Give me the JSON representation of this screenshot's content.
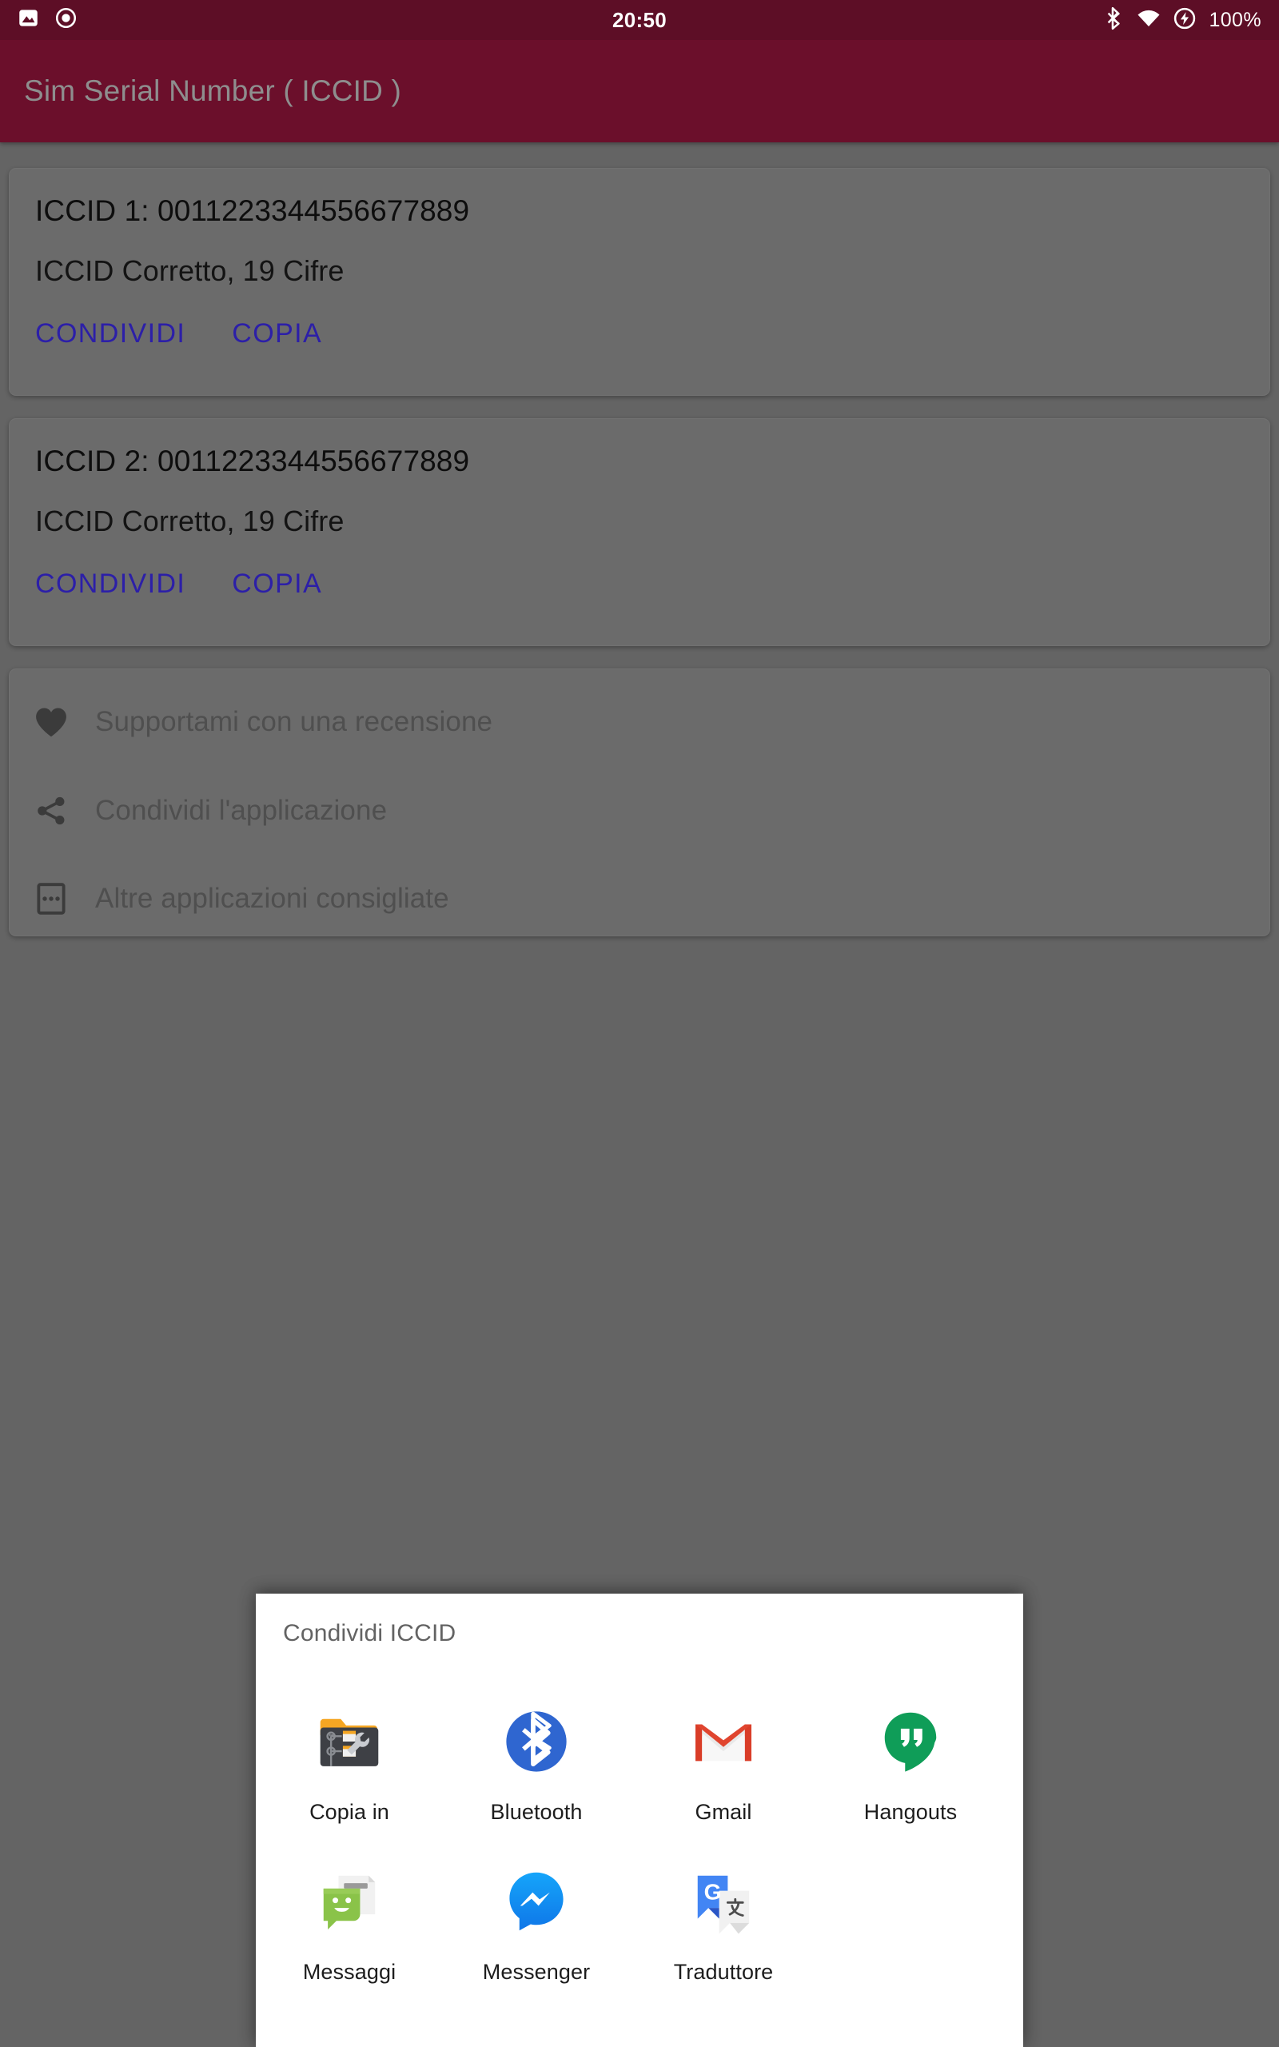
{
  "status_bar": {
    "time": "20:50",
    "battery_percent": "100%",
    "left_icons": [
      "image-icon",
      "record-icon"
    ],
    "right_icons": [
      "bluetooth-icon",
      "wifi-icon",
      "battery-charging-icon"
    ],
    "background_color": "#5d0e26"
  },
  "app_bar": {
    "title": "Sim Serial Number ( ICCID )",
    "background_color": "#6b0f2b",
    "title_color": "#8e8e8e"
  },
  "accent_color": "#2c1fa8",
  "page_background": "#646464",
  "card_background": "#6b6b6b",
  "sim_cards": [
    {
      "label": "ICCID 1: 0011223344556677889",
      "status": "ICCID Corretto, 19 Cifre",
      "share_label": "CONDIVIDI",
      "copy_label": "COPIA"
    },
    {
      "label": "ICCID 2: 0011223344556677889",
      "status": "ICCID Corretto, 19 Cifre",
      "share_label": "CONDIVIDI",
      "copy_label": "COPIA"
    }
  ],
  "links_card": {
    "items": [
      {
        "icon": "heart-icon",
        "label": "Supportami con una recensione"
      },
      {
        "icon": "share-nodes-icon",
        "label": "Condividi l'applicazione"
      },
      {
        "icon": "more-apps-icon",
        "label": "Altre applicazioni consigliate"
      }
    ]
  },
  "share_dialog": {
    "title": "Condividi ICCID",
    "apps": [
      {
        "name": "Copia in",
        "icon": "file-manager-icon"
      },
      {
        "name": "Bluetooth",
        "icon": "bluetooth-app-icon"
      },
      {
        "name": "Gmail",
        "icon": "gmail-icon"
      },
      {
        "name": "Hangouts",
        "icon": "hangouts-icon"
      },
      {
        "name": "Messaggi",
        "icon": "messages-icon"
      },
      {
        "name": "Messenger",
        "icon": "messenger-icon"
      },
      {
        "name": "Traduttore",
        "icon": "google-translate-icon"
      }
    ]
  }
}
